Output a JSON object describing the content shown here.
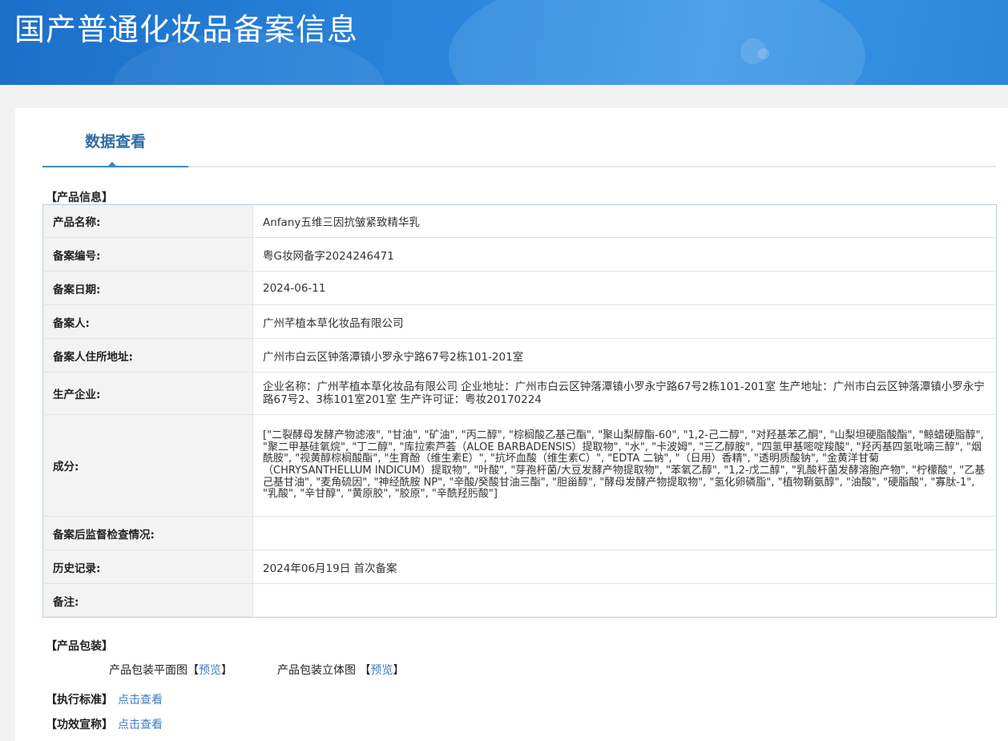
{
  "header": {
    "title": "国产普通化妆品备案信息"
  },
  "tabs": [
    {
      "label": "数据查看"
    }
  ],
  "sections": {
    "product_info": "【产品信息】",
    "packaging": "【产品包装】",
    "standard": "【执行标准】",
    "efficacy": "【功效宣称】"
  },
  "product_info": {
    "rows": [
      {
        "key": "产品名称:",
        "value": "Anfany五维三因抗皱紧致精华乳"
      },
      {
        "key": "备案编号:",
        "value": "粤G妆网备字2024246471"
      },
      {
        "key": "备案日期:",
        "value": "2024-06-11"
      },
      {
        "key": "备案人:",
        "value": "广州芊植本草化妆品有限公司"
      },
      {
        "key": "备案人住所地址:",
        "value": "广州市白云区钟落潭镇小罗永宁路67号2栋101-201室"
      },
      {
        "key": "生产企业:",
        "value": "企业名称：广州芊植本草化妆品有限公司 企业地址：广州市白云区钟落潭镇小罗永宁路67号2栋101-201室 生产地址：广州市白云区钟落潭镇小罗永宁路67号2、3栋101室201室 生产许可证：粤妆20170224"
      },
      {
        "key": "成分:",
        "value": "[\"二裂酵母发酵产物滤液\", \"甘油\", \"矿油\", \"丙二醇\", \"棕榈酸乙基己酯\", \"聚山梨醇酯-60\", \"1,2-己二醇\", \"对羟基苯乙酮\", \"山梨坦硬脂酸酯\", \"鲸蜡硬脂醇\", \"聚二甲基硅氧烷\", \"丁二醇\", \"库拉索芦荟（ALOE BARBADENSIS）提取物\", \"水\", \"卡波姆\", \"三乙醇胺\", \"四氢甲基嘧啶羧酸\", \"羟丙基四氢吡喃三醇\", \"烟酰胺\", \"视黄醇棕榈酸酯\", \"生育酚（维生素E）\", \"抗坏血酸（维生素C）\", \"EDTA 二钠\", \"（日用）香精\", \"透明质酸钠\", \"金黄洋甘菊（CHRYSANTHELLUM INDICUM）提取物\", \"叶酸\", \"芽孢杆菌/大豆发酵产物提取物\", \"苯氧乙醇\", \"1,2-戊二醇\", \"乳酸杆菌发酵溶胞产物\", \"柠檬酸\", \"乙基己基甘油\", \"麦角硫因\", \"神经酰胺 NP\", \"辛酸/癸酸甘油三酯\", \"胆甾醇\", \"酵母发酵产物提取物\", \"氢化卵磷脂\", \"植物鞘氨醇\", \"油酸\", \"硬脂酸\", \"寡肽-1\", \"乳酸\", \"辛甘醇\", \"黄原胶\", \"胶原\", \"辛酰羟肟酸\"]"
      },
      {
        "key": "备案后监督检查情况:",
        "value": ""
      },
      {
        "key": "历史记录:",
        "value": "2024年06月19日 首次备案"
      },
      {
        "key": "备注:",
        "value": ""
      }
    ]
  },
  "packaging": {
    "flat_label": "产品包装平面图",
    "flat_link": "【预览】",
    "solid_label": "产品包装立体图 ",
    "solid_link": "【预览】"
  },
  "standard": {
    "link": "点击查看"
  },
  "efficacy": {
    "link": "点击查看"
  }
}
